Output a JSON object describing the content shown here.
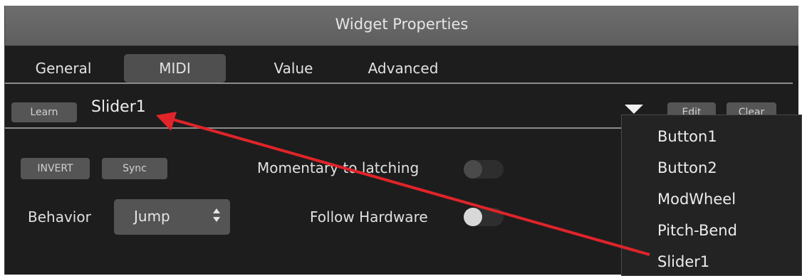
{
  "window": {
    "title": "Widget Properties"
  },
  "tabs": [
    {
      "label": "General",
      "active": false
    },
    {
      "label": "MIDI",
      "active": true
    },
    {
      "label": "Value",
      "active": false
    },
    {
      "label": "Advanced",
      "active": false
    }
  ],
  "mapping": {
    "learn_label": "Learn",
    "current": "Slider1",
    "edit_label": "Edit",
    "clear_label": "Clear"
  },
  "options": {
    "invert_label": "INVERT",
    "sync_label": "Sync",
    "momentary_label": "Momentary to latching",
    "momentary_on": false,
    "follow_label": "Follow Hardware",
    "follow_on": false,
    "behavior_label": "Behavior",
    "behavior_value": "Jump"
  },
  "dropdown": {
    "items": [
      "Button1",
      "Button2",
      "ModWheel",
      "Pitch-Bend",
      "Slider1"
    ]
  },
  "colors": {
    "annotation_arrow": "#e0242a",
    "panel_bg": "#1d1d1d",
    "titlebar": "#666666"
  }
}
